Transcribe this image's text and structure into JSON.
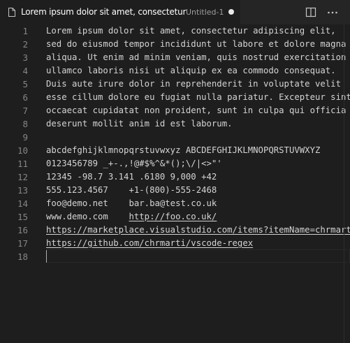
{
  "tab": {
    "title": "Lorem ipsum dolor sit amet, consectetur",
    "description": "Untitled-1",
    "dirty": true,
    "icon": "file-icon"
  },
  "actions": [
    {
      "name": "split-editor-icon"
    },
    {
      "name": "more-actions-icon"
    }
  ],
  "editor": {
    "current_line": 18,
    "lines": [
      {
        "n": "1",
        "text": "Lorem ipsum dolor sit amet, consectetur adipiscing elit,"
      },
      {
        "n": "2",
        "text": "sed do eiusmod tempor incididunt ut labore et dolore magna"
      },
      {
        "n": "3",
        "text": "aliqua. Ut enim ad minim veniam, quis nostrud exercitation"
      },
      {
        "n": "4",
        "text": "ullamco laboris nisi ut aliquip ex ea commodo consequat."
      },
      {
        "n": "5",
        "text": "Duis aute irure dolor in reprehenderit in voluptate velit"
      },
      {
        "n": "6",
        "text": "esse cillum dolore eu fugiat nulla pariatur. Excepteur sint"
      },
      {
        "n": "7",
        "text": "occaecat cupidatat non proident, sunt in culpa qui officia"
      },
      {
        "n": "8",
        "text": "deserunt mollit anim id est laborum."
      },
      {
        "n": "9",
        "text": ""
      },
      {
        "n": "10",
        "text": "abcdefghijklmnopqrstuvwxyz ABCDEFGHIJKLMNOPQRSTUVWXYZ"
      },
      {
        "n": "11",
        "text": "0123456789 _+-.,!@#$%^&*();\\/|<>\"'"
      },
      {
        "n": "12",
        "text": "12345 -98.7 3.141 .6180 9,000 +42"
      },
      {
        "n": "13",
        "text": "555.123.4567    +1-(800)-555-2468"
      },
      {
        "n": "14",
        "text": "foo@demo.net    bar.ba@test.co.uk"
      },
      {
        "n": "15",
        "text": "www.demo.com    ",
        "link": "http://foo.co.uk/"
      },
      {
        "n": "16",
        "text": "",
        "link": "https://marketplace.visualstudio.com/items?itemName=chrmarti.regex"
      },
      {
        "n": "17",
        "text": "",
        "link": "https://github.com/chrmarti/vscode-regex"
      },
      {
        "n": "18",
        "text": ""
      }
    ]
  },
  "colors": {
    "background": "#1e1e1e",
    "tabbar": "#252526",
    "text": "#d4d4d4",
    "line_number": "#858585",
    "tab_title": "#ffffff"
  }
}
